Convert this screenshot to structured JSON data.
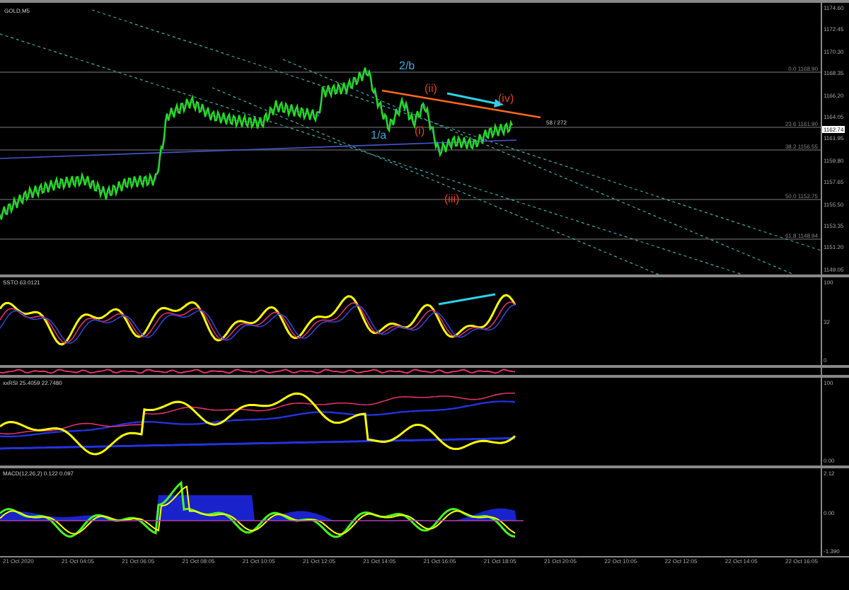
{
  "chart": {
    "symbol": "GOLD,M5",
    "current_price": "1162.74",
    "ray_label": "58 / 272",
    "price_axis": [
      "1174.60",
      "1172.45",
      "1170.30",
      "1168.35",
      "1166.20",
      "1164.05",
      "1161.95",
      "1159.80",
      "1157.65",
      "1155.50",
      "1153.35",
      "1151.20",
      "1149.05"
    ],
    "fib_levels": [
      {
        "text": "0.0 1168.90"
      },
      {
        "text": "23.6 1161.90"
      },
      {
        "text": "38.2 1156.55"
      },
      {
        "text": "50.0 1152.75"
      },
      {
        "text": "61.8 1148.94"
      }
    ],
    "wave_labels": [
      {
        "text": "2/b",
        "color": "#3fa9d6"
      },
      {
        "text": "1/a",
        "color": "#3fa9d6"
      },
      {
        "text": "(i)",
        "color": "#e0402a"
      },
      {
        "text": "(ii)",
        "color": "#e0402a"
      },
      {
        "text": "(iii)",
        "color": "#e0402a"
      },
      {
        "text": "(iv)",
        "color": "#e0402a"
      }
    ]
  },
  "indicators": [
    {
      "kind": "stoch",
      "title": "SSTO 63.0121",
      "axis": [
        "100",
        "32",
        "0"
      ]
    },
    {
      "kind": "strip"
    },
    {
      "kind": "rsi",
      "title": "xxRSI 25.4059 22.7480",
      "axis": [
        "100",
        "0.00"
      ]
    },
    {
      "kind": "macd",
      "title": "MACD(12,26,2) 0.122 0.097",
      "axis": [
        "2.12",
        "0.00",
        "-1.390"
      ]
    }
  ],
  "time_axis": [
    "21 Oct 2020",
    "21 Oct 04:05",
    "21 Oct 06:05",
    "21 Oct 08:05",
    "21 Oct 10:05",
    "21 Oct 12:05",
    "21 Oct 14:05",
    "21 Oct 16:05",
    "21 Oct 18:05",
    "21 Oct 20:05",
    "22 Oct 10:05",
    "22 Oct 12:05",
    "22 Oct 14:05",
    "22 Oct 16:05"
  ]
}
